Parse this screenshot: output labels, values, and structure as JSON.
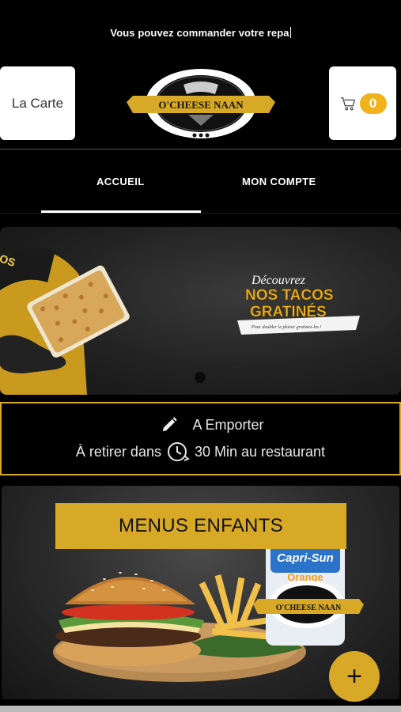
{
  "announcement": {
    "text": "Vous pouvez commander votre repa"
  },
  "header": {
    "menu_label": "La Carte",
    "cart_count": "0",
    "logo_text": "O'CHEESE NAAN",
    "cart_icon": "cart-icon"
  },
  "tabs": [
    {
      "label": "ACCUEIL",
      "active": true
    },
    {
      "label": "MON COMPTE",
      "active": false
    }
  ],
  "banner": {
    "headline_script": "Découvrez",
    "headline_1": "NOS TACOS",
    "headline_2": "GRATINÉS",
    "tagline": "Pour doubler le plaisir gratinez-les !",
    "slide_index": 1
  },
  "pickup": {
    "icon": "pencil-icon",
    "mode": "A Emporter",
    "prefix": "À retirer dans",
    "clock_icon": "clock-icon",
    "time_text": "30 Min au restaurant"
  },
  "category_card": {
    "title": "MENUS ENFANTS",
    "drink_brand": "Capri-Sun",
    "drink_flavor": "Orange",
    "logo_text": "O'CHEESE NAAN",
    "add_label": "+"
  },
  "colors": {
    "accent": "#d8a926",
    "badge": "#f2b21b",
    "background": "#000000"
  }
}
